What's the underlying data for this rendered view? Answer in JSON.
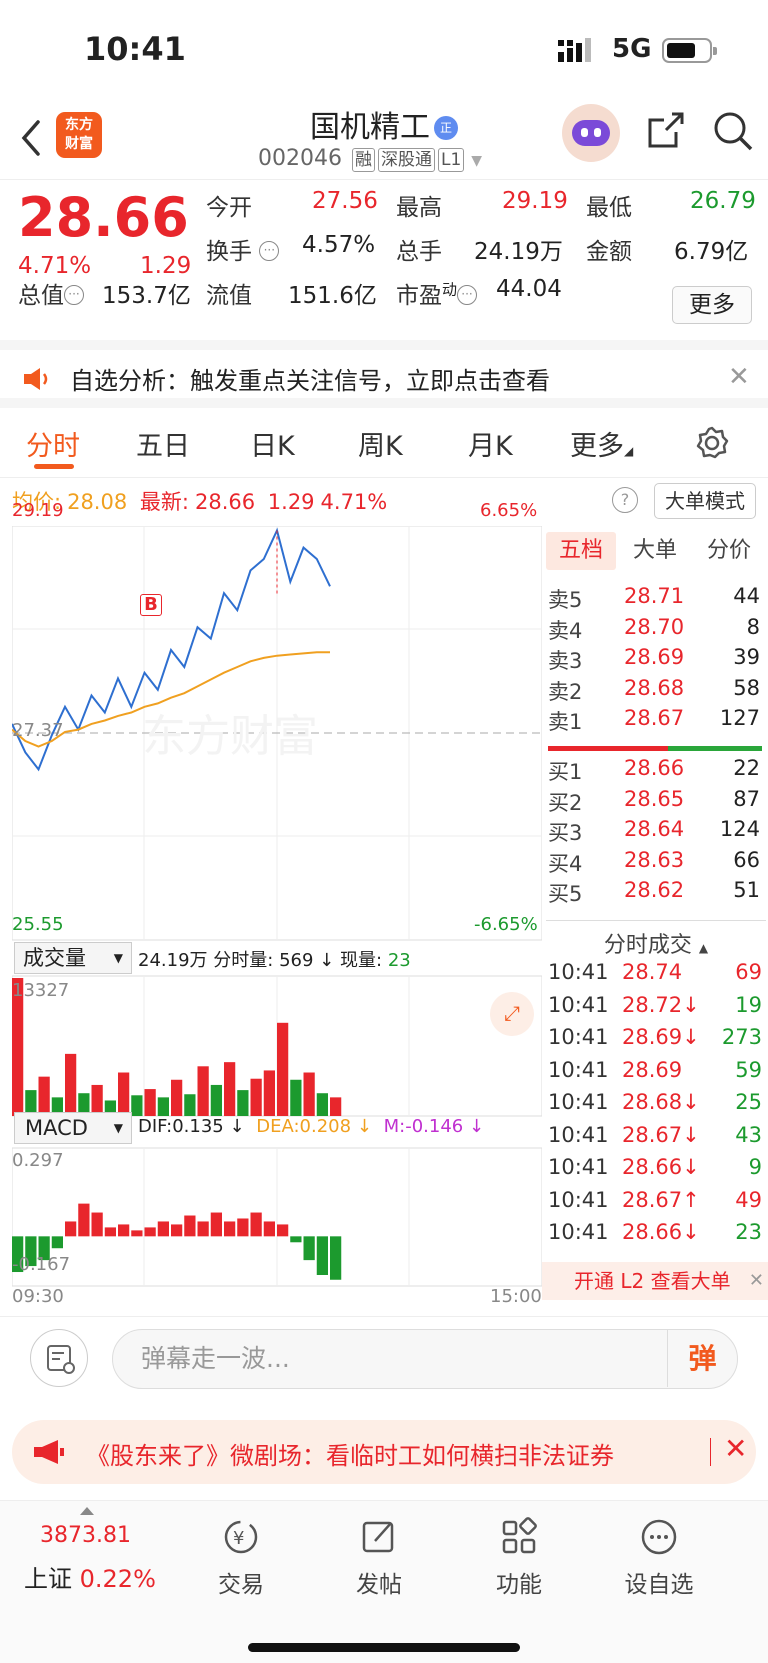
{
  "status_bar": {
    "time": "10:41",
    "network": "5G",
    "battery_level": 0.7
  },
  "header": {
    "logo_text": "东方\n财富",
    "logo_line1": "东方",
    "logo_line2": "财富",
    "stock_name": "国机精工",
    "badge": "正",
    "stock_code": "002046",
    "tags": [
      "融",
      "深股通",
      "L1"
    ]
  },
  "quote": {
    "price": "28.66",
    "change_pct": "4.71%",
    "change": "1.29",
    "rows": [
      [
        {
          "label": "今开",
          "value": "27.56",
          "color": "red"
        },
        {
          "label": "最高",
          "value": "29.19",
          "color": "red"
        },
        {
          "label": "最低",
          "value": "26.79",
          "color": "green"
        }
      ],
      [
        {
          "label": "换手",
          "value": "4.57%"
        },
        {
          "label": "总手",
          "value": "24.19万"
        },
        {
          "label": "金额",
          "value": "6.79亿"
        }
      ],
      [
        {
          "label": "总值",
          "value": "153.7亿"
        },
        {
          "label": "流值",
          "value": "151.6亿"
        },
        {
          "label": "市盈",
          "sup": "动",
          "value": "44.04"
        }
      ]
    ],
    "more_label": "更多"
  },
  "banner": {
    "text": "自选分析：触发重点关注信号，立即点击查看"
  },
  "tabs": [
    "分时",
    "五日",
    "日K",
    "周K",
    "月K",
    "更多"
  ],
  "active_tab": "分时",
  "avg": {
    "avg_label": "均价:",
    "avg_value": "28.08",
    "latest_label": "最新:",
    "latest_value": "28.66",
    "change": "1.29",
    "pct": "4.71%",
    "mode_button": "大单模式"
  },
  "chart_labels": {
    "high": "29.19",
    "high_pct": "6.65%",
    "base": "27.37",
    "low": "25.55",
    "low_pct": "-6.65%",
    "start_time": "09:30",
    "end_time": "15:00",
    "watermark": "东方财富",
    "buy_marker": "B"
  },
  "volume": {
    "selector": "成交量",
    "total": "24.19万",
    "minute_label": "分时量:",
    "minute_value": "569",
    "arrow": "↓",
    "now_label": "现量:",
    "now_value": "23",
    "max": "13327"
  },
  "macd": {
    "selector": "MACD",
    "dif": "DIF:0.135 ↓",
    "dea": "DEA:0.208 ↓",
    "m": "M:-0.146 ↓",
    "top": "0.297",
    "bottom": "-0.167"
  },
  "chart_data": [
    {
      "type": "line",
      "title": "",
      "series": [
        {
          "values": [
            27.45,
            27.2,
            27.05,
            27.35,
            27.6,
            27.4,
            27.7,
            27.55,
            27.85,
            27.6,
            27.9,
            27.75,
            28.1,
            27.95,
            28.3,
            28.2,
            28.6,
            28.45,
            28.8,
            28.9,
            29.15,
            28.7,
            29.0,
            28.9,
            28.66
          ]
        },
        {
          "values": [
            27.4,
            27.3,
            27.25,
            27.3,
            27.38,
            27.4,
            27.45,
            27.48,
            27.52,
            27.55,
            27.6,
            27.63,
            27.68,
            27.72,
            27.78,
            27.84,
            27.9,
            27.95,
            28.0,
            28.03,
            28.05,
            28.06,
            28.07,
            28.08,
            28.08
          ]
        }
      ],
      "ylim": [
        25.55,
        29.19
      ],
      "xlabel": "",
      "ylabel": ""
    },
    {
      "type": "bar",
      "title": "成交量",
      "values": [
        13327,
        2500,
        3800,
        1800,
        6000,
        2200,
        3000,
        1500,
        4200,
        2000,
        2600,
        1800,
        3500,
        2100,
        4800,
        3000,
        5200,
        2500,
        3600,
        4400,
        9000,
        3500,
        4200,
        2200,
        1800
      ],
      "ylim": [
        0,
        13327
      ]
    },
    {
      "type": "bar",
      "title": "MACD",
      "values": [
        -0.12,
        -0.1,
        -0.08,
        -0.04,
        0.05,
        0.11,
        0.08,
        0.03,
        0.04,
        0.02,
        0.03,
        0.05,
        0.04,
        0.07,
        0.05,
        0.08,
        0.05,
        0.06,
        0.08,
        0.05,
        0.04,
        -0.02,
        -0.08,
        -0.13,
        -0.146
      ],
      "ylim": [
        -0.167,
        0.297
      ]
    }
  ],
  "order_book": {
    "tabs": [
      "五档",
      "大单",
      "分价"
    ],
    "asks": [
      {
        "label": "卖5",
        "price": "28.71",
        "vol": "44"
      },
      {
        "label": "卖4",
        "price": "28.70",
        "vol": "8"
      },
      {
        "label": "卖3",
        "price": "28.69",
        "vol": "39"
      },
      {
        "label": "卖2",
        "price": "28.68",
        "vol": "58"
      },
      {
        "label": "卖1",
        "price": "28.67",
        "vol": "127"
      }
    ],
    "bids": [
      {
        "label": "买1",
        "price": "28.66",
        "vol": "22"
      },
      {
        "label": "买2",
        "price": "28.65",
        "vol": "87"
      },
      {
        "label": "买3",
        "price": "28.64",
        "vol": "124"
      },
      {
        "label": "买4",
        "price": "28.63",
        "vol": "66"
      },
      {
        "label": "买5",
        "price": "28.62",
        "vol": "51"
      }
    ]
  },
  "tick_trades": {
    "title": "分时成交",
    "rows": [
      {
        "time": "10:41",
        "price": "28.74",
        "arrow": "",
        "vol": "69",
        "vol_color": "red"
      },
      {
        "time": "10:41",
        "price": "28.72",
        "arrow": "↓",
        "vol": "19",
        "vol_color": "green"
      },
      {
        "time": "10:41",
        "price": "28.69",
        "arrow": "↓",
        "vol": "273",
        "vol_color": "green"
      },
      {
        "time": "10:41",
        "price": "28.69",
        "arrow": "",
        "vol": "59",
        "vol_color": "green"
      },
      {
        "time": "10:41",
        "price": "28.68",
        "arrow": "↓",
        "vol": "25",
        "vol_color": "green"
      },
      {
        "time": "10:41",
        "price": "28.67",
        "arrow": "↓",
        "vol": "43",
        "vol_color": "green"
      },
      {
        "time": "10:41",
        "price": "28.66",
        "arrow": "↓",
        "vol": "9",
        "vol_color": "green"
      },
      {
        "time": "10:41",
        "price": "28.67",
        "arrow": "↑",
        "vol": "49",
        "vol_color": "red"
      },
      {
        "time": "10:41",
        "price": "28.66",
        "arrow": "↓",
        "vol": "23",
        "vol_color": "green"
      }
    ],
    "l2_button": "开通 L2 查看大单"
  },
  "comment": {
    "placeholder": "弹幕走一波...",
    "dan_button": "弹"
  },
  "ad": {
    "text": "《股东来了》微剧场：看临时工如何横扫非法证券"
  },
  "bottom_nav": {
    "index_value": "3873.81",
    "index_name": "上证",
    "index_pct": "0.22%",
    "items": [
      "交易",
      "发帖",
      "功能",
      "设自选"
    ]
  },
  "colors": {
    "up": "#e8262c",
    "down": "#1c9a2e",
    "brand": "#f25a1e",
    "avg_line": "#f0a020",
    "price_line": "#2e6fd0"
  }
}
